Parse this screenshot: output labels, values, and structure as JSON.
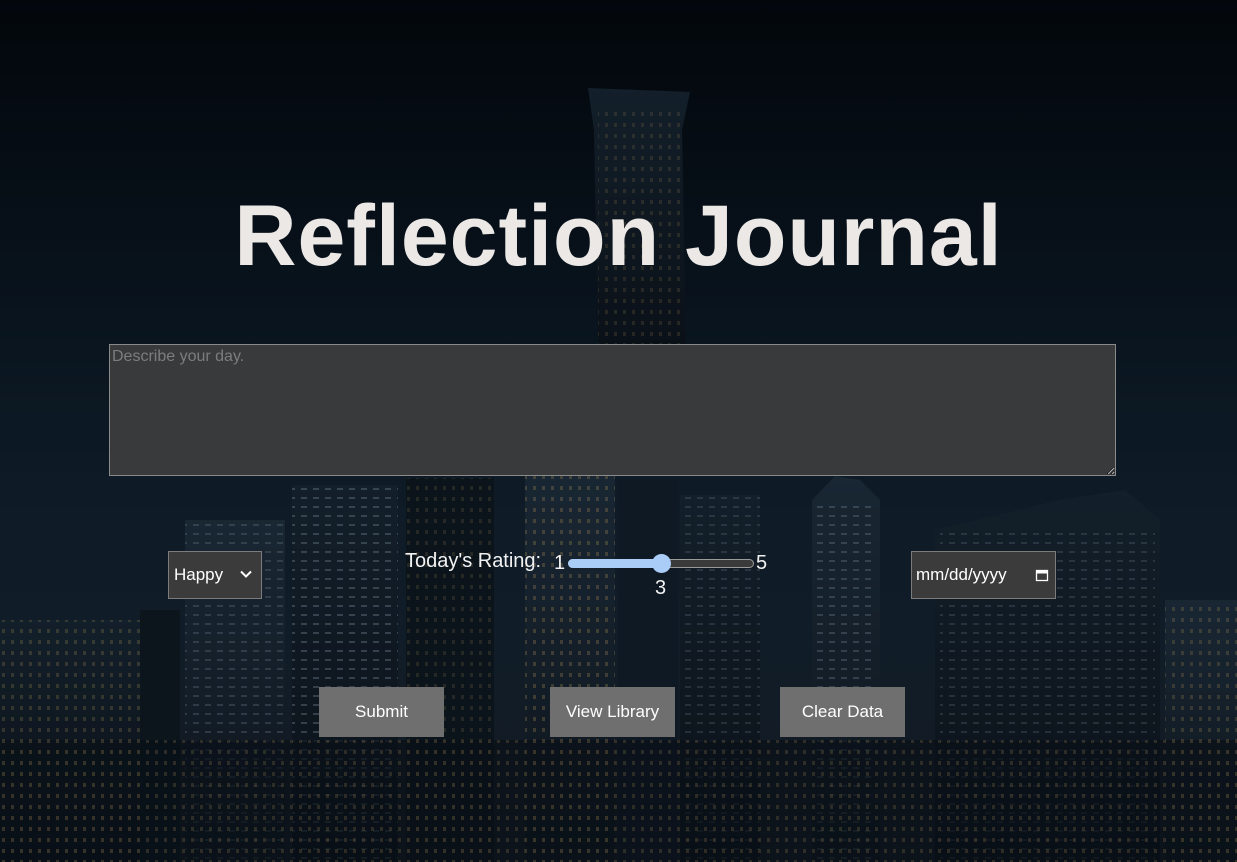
{
  "title": "Reflection Journal",
  "journal": {
    "placeholder": "Describe your day.",
    "value": ""
  },
  "mood": {
    "selected": "Happy",
    "icon": "chevron-down-icon"
  },
  "rating": {
    "label": "Today's Rating:",
    "min_label": "1",
    "max_label": "5",
    "value_label": "3",
    "min": 1,
    "max": 5,
    "value": 3,
    "accent_color": "#a9cdf7"
  },
  "date": {
    "placeholder": "mm/dd/yyyy",
    "icon": "calendar-icon"
  },
  "buttons": {
    "submit": "Submit",
    "view_library": "View Library",
    "clear_data": "Clear Data"
  },
  "colors": {
    "button_bg": "#6f6f6f",
    "field_bg": "#3b3b3b",
    "title_color": "#ebe8e6"
  }
}
